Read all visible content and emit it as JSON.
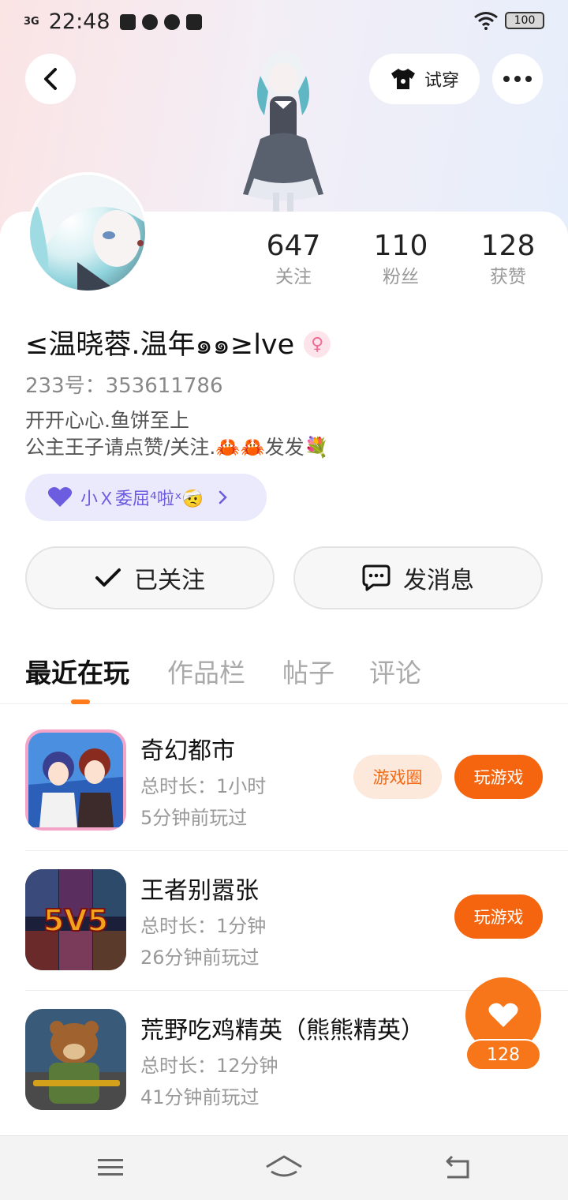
{
  "status_bar": {
    "network": "3G",
    "time": "22:48",
    "battery": "100"
  },
  "top": {
    "tryon_label": "试穿"
  },
  "profile": {
    "stats": [
      {
        "value": "647",
        "label": "关注"
      },
      {
        "value": "110",
        "label": "粉丝"
      },
      {
        "value": "128",
        "label": "获赞"
      }
    ],
    "username": "≤温晓蓉.温年๑๑≥lve",
    "id_line": "233号：353611786",
    "bio_line1": "开开心心.鱼饼至上",
    "bio_line2": "公主王子请点赞/关注.🦀🦀发发💐",
    "tag": "小Ｘ委屈⁴啦ˣ🤕"
  },
  "actions": {
    "followed_label": "已关注",
    "message_label": "发消息"
  },
  "tabs": [
    "最近在玩",
    "作品栏",
    "帖子",
    "评论"
  ],
  "games": [
    {
      "title": "奇幻都市",
      "duration": "总时长：1小时",
      "last_played": "5分钟前玩过",
      "circle_label": "游戏圈",
      "play_label": "玩游戏"
    },
    {
      "title": "王者别嚣张",
      "duration": "总时长：1分钟",
      "last_played": "26分钟前玩过",
      "play_label": "玩游戏"
    },
    {
      "title": "荒野吃鸡精英（熊熊精英）",
      "duration": "总时长：12分钟",
      "last_played": "41分钟前玩过"
    }
  ],
  "like_fab": {
    "count": "128"
  },
  "colors": {
    "accent": "#f5650f",
    "tag_bg": "#ebeafc",
    "tag_text": "#6c5ce0"
  }
}
